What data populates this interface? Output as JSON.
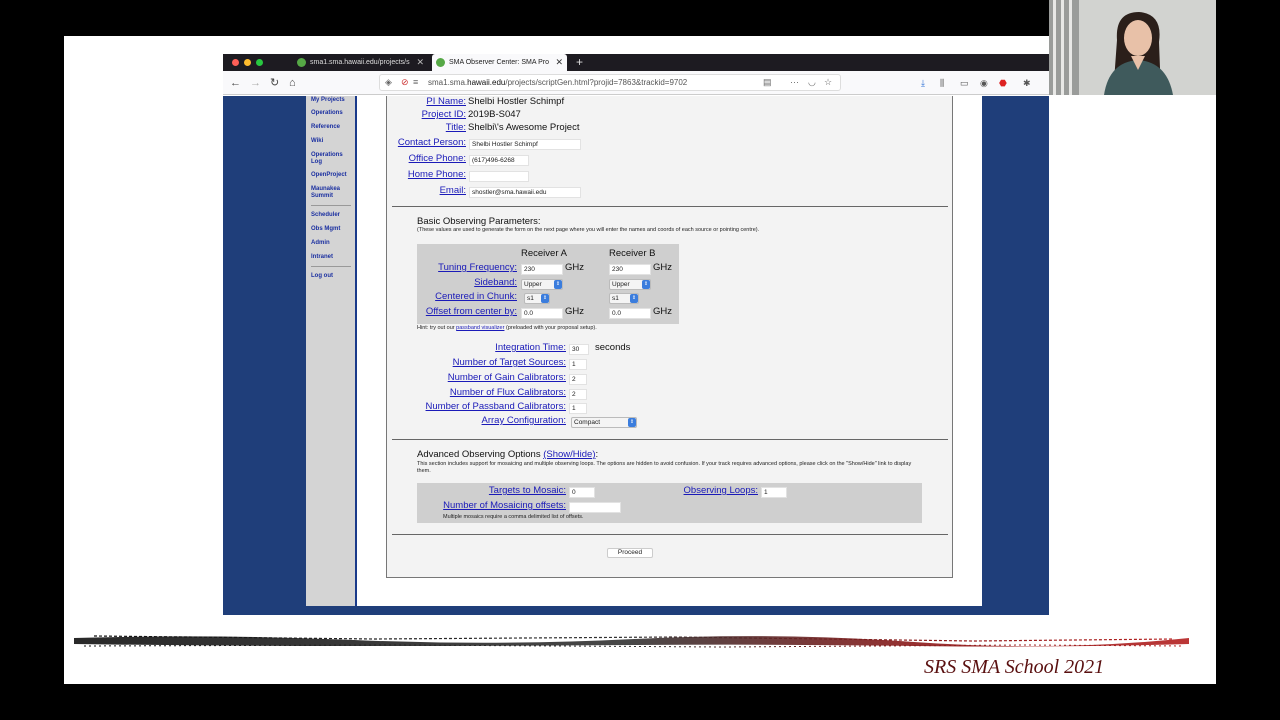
{
  "browser": {
    "tabs": [
      {
        "label": "sma1.sma.hawaii.edu/projects/s"
      },
      {
        "label": "SMA Observer Center: SMA Pro"
      }
    ],
    "url_prefix": "sma1.sma.",
    "url_domain": "hawaii.edu",
    "url_path": "/projects/scriptGen.html?projid=7863&trackid=9702"
  },
  "leftnav": {
    "items": [
      "My Projects",
      "Operations",
      "Reference",
      "Wiki",
      "Operations Log",
      "OpenProject",
      "Maunakea Summit",
      "Scheduler",
      "Obs Mgmt",
      "Admin",
      "Intranet",
      "Log out"
    ]
  },
  "project": {
    "pi_label": "PI Name:",
    "pi_value": "Shelbi Hostler Schimpf",
    "id_label": "Project ID:",
    "id_value": "2019B-S047",
    "title_label": "Title:",
    "title_value": "Shelbi\\'s Awesome Project",
    "contact_label": "Contact Person:",
    "contact_value": "Shelbi Hostler Schimpf",
    "office_label": "Office Phone:",
    "office_value": "(617)496-6268",
    "home_label": "Home Phone:",
    "home_value": "",
    "email_label": "Email:",
    "email_value": "shostler@sma.hawaii.edu"
  },
  "basic": {
    "heading": "Basic Observing Parameters:",
    "note": "(These values are used to generate the form on the next page where you will enter the names and coords of each source or pointing centre).",
    "receiver_a": "Receiver A",
    "receiver_b": "Receiver B",
    "tuning_label": "Tuning Frequency:",
    "tuning_a": "230",
    "tuning_b": "230",
    "unit_ghz": "GHz",
    "sideband_label": "Sideband:",
    "sideband_a": "Upper",
    "sideband_b": "Upper",
    "chunk_label": "Centered in Chunk:",
    "chunk_a": "s1",
    "chunk_b": "s1",
    "offset_label": "Offset from center by:",
    "offset_a": "0.0",
    "offset_b": "0.0",
    "hint_prefix": "Hint: try out our",
    "hint_link": "passband visualizer",
    "hint_suffix": "(preloaded with your proposal setup).",
    "integration_label": "Integration Time:",
    "integration_value": "30",
    "integration_unit": "seconds",
    "targets_label": "Number of Target Sources:",
    "targets_value": "1",
    "gain_label": "Number of Gain Calibrators:",
    "gain_value": "2",
    "flux_label": "Number of Flux Calibrators:",
    "flux_value": "2",
    "passband_label": "Number of Passband Calibrators:",
    "passband_value": "1",
    "array_label": "Array Configuration:",
    "array_value": "Compact"
  },
  "advanced": {
    "heading": "Advanced Observing Options",
    "showhide": "(Show/Hide)",
    "colon": ":",
    "note": "This section includes support for mosaicing and multiple observing loops. The options are hidden to avoid confusion. If your track requires advanced options, please click on the \"Show/Hide\" link to display them.",
    "mosaic_label": "Targets to Mosaic:",
    "mosaic_value": "0",
    "loops_label": "Observing Loops:",
    "loops_value": "1",
    "offsets_label": "Number of Mosaicing offsets:",
    "offsets_value": "",
    "offsets_note": "Multiple mosaics require a comma delimited list of offsets."
  },
  "proceed_label": "Proceed",
  "footer": "SRS SMA School 2021"
}
